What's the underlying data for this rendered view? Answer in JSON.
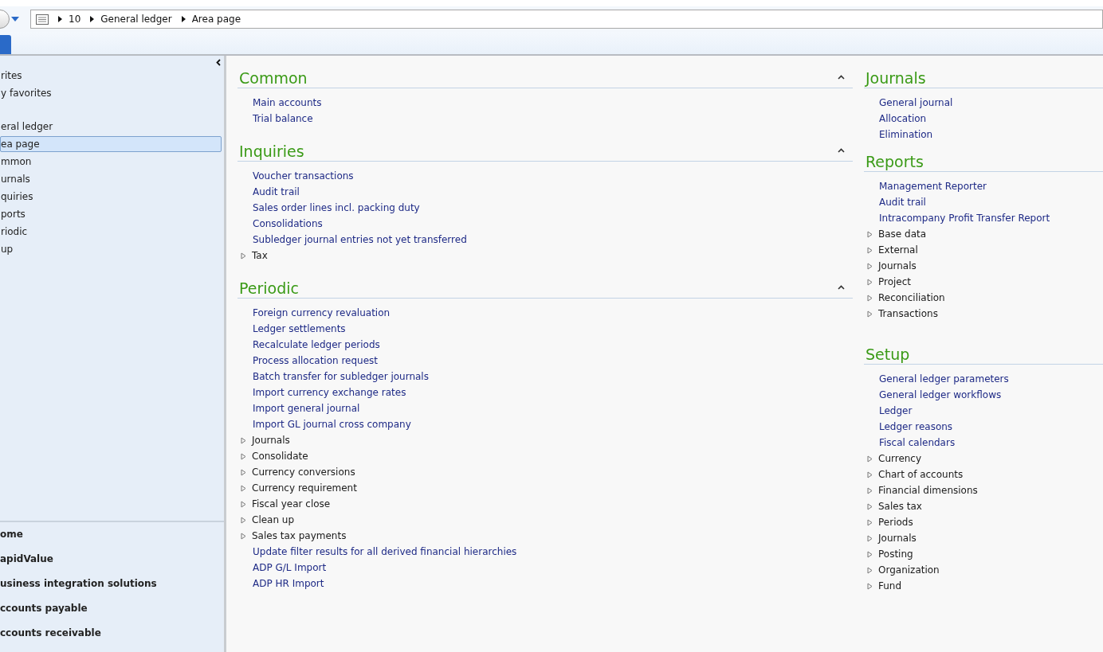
{
  "address_bar": {
    "breadcrumb": [
      "10",
      "General ledger",
      "Area page"
    ]
  },
  "navigation_pane": {
    "items": [
      {
        "label": "rites",
        "selected": false
      },
      {
        "label": "y favorites",
        "selected": false
      },
      {
        "label": "eral ledger",
        "selected": false,
        "kind": "spaced"
      },
      {
        "label": "ea page",
        "selected": true
      },
      {
        "label": "mmon",
        "selected": false
      },
      {
        "label": "urnals",
        "selected": false
      },
      {
        "label": "quiries",
        "selected": false
      },
      {
        "label": "ports",
        "selected": false
      },
      {
        "label": "riodic",
        "selected": false
      },
      {
        "label": "up",
        "selected": false
      }
    ],
    "modules": [
      "ome",
      "apidValue",
      "usiness integration solutions",
      "ccounts payable",
      "ccounts receivable"
    ]
  },
  "columns": [
    [
      {
        "title": "Common",
        "expanded": true,
        "items": [
          {
            "label": "Main accounts",
            "kind": "link"
          },
          {
            "label": "Trial balance",
            "kind": "link"
          }
        ]
      },
      {
        "title": "Inquiries",
        "expanded": true,
        "items": [
          {
            "label": "Voucher transactions",
            "kind": "link"
          },
          {
            "label": "Audit trail",
            "kind": "link"
          },
          {
            "label": "Sales order lines incl. packing duty",
            "kind": "link"
          },
          {
            "label": "Consolidations",
            "kind": "link"
          },
          {
            "label": "Subledger journal entries not yet transferred",
            "kind": "link"
          },
          {
            "label": "Tax",
            "kind": "group"
          }
        ]
      },
      {
        "title": "Periodic",
        "expanded": true,
        "items": [
          {
            "label": "Foreign currency revaluation",
            "kind": "link"
          },
          {
            "label": "Ledger settlements",
            "kind": "link"
          },
          {
            "label": "Recalculate ledger periods",
            "kind": "link"
          },
          {
            "label": "Process allocation request",
            "kind": "link"
          },
          {
            "label": "Batch transfer for subledger journals",
            "kind": "link"
          },
          {
            "label": "Import currency exchange rates",
            "kind": "link"
          },
          {
            "label": "Import general journal",
            "kind": "link"
          },
          {
            "label": "Import GL journal cross company",
            "kind": "link"
          },
          {
            "label": "Journals",
            "kind": "group"
          },
          {
            "label": "Consolidate",
            "kind": "group"
          },
          {
            "label": "Currency conversions",
            "kind": "group"
          },
          {
            "label": "Currency requirement",
            "kind": "group"
          },
          {
            "label": "Fiscal year close",
            "kind": "group"
          },
          {
            "label": "Clean up",
            "kind": "group"
          },
          {
            "label": "Sales tax payments",
            "kind": "group"
          },
          {
            "label": "Update filter results for all derived financial hierarchies",
            "kind": "link"
          },
          {
            "label": "ADP G/L Import",
            "kind": "link"
          },
          {
            "label": "ADP HR Import",
            "kind": "link"
          }
        ]
      }
    ],
    [
      {
        "title": "Journals",
        "items": [
          {
            "label": "General journal",
            "kind": "link"
          },
          {
            "label": "Allocation",
            "kind": "link"
          },
          {
            "label": "Elimination",
            "kind": "link"
          }
        ]
      },
      {
        "title": "Reports",
        "items": [
          {
            "label": "Management Reporter",
            "kind": "link"
          },
          {
            "label": "Audit trail",
            "kind": "link"
          },
          {
            "label": "Intracompany Profit Transfer Report",
            "kind": "link"
          },
          {
            "label": "Base data",
            "kind": "group"
          },
          {
            "label": "External",
            "kind": "group"
          },
          {
            "label": "Journals",
            "kind": "group"
          },
          {
            "label": "Project",
            "kind": "group"
          },
          {
            "label": "Reconciliation",
            "kind": "group"
          },
          {
            "label": "Transactions",
            "kind": "group"
          }
        ]
      },
      {
        "title": "Setup",
        "items": [
          {
            "label": "General ledger parameters",
            "kind": "link"
          },
          {
            "label": "General ledger workflows",
            "kind": "link"
          },
          {
            "label": "Ledger",
            "kind": "link"
          },
          {
            "label": "Ledger reasons",
            "kind": "link"
          },
          {
            "label": "Fiscal calendars",
            "kind": "link"
          },
          {
            "label": "Currency",
            "kind": "group"
          },
          {
            "label": "Chart of accounts",
            "kind": "group"
          },
          {
            "label": "Financial dimensions",
            "kind": "group"
          },
          {
            "label": "Sales tax",
            "kind": "group"
          },
          {
            "label": "Periods",
            "kind": "group"
          },
          {
            "label": "Journals",
            "kind": "group"
          },
          {
            "label": "Posting",
            "kind": "group"
          },
          {
            "label": "Organization",
            "kind": "group"
          },
          {
            "label": "Fund",
            "kind": "group"
          }
        ]
      }
    ]
  ]
}
